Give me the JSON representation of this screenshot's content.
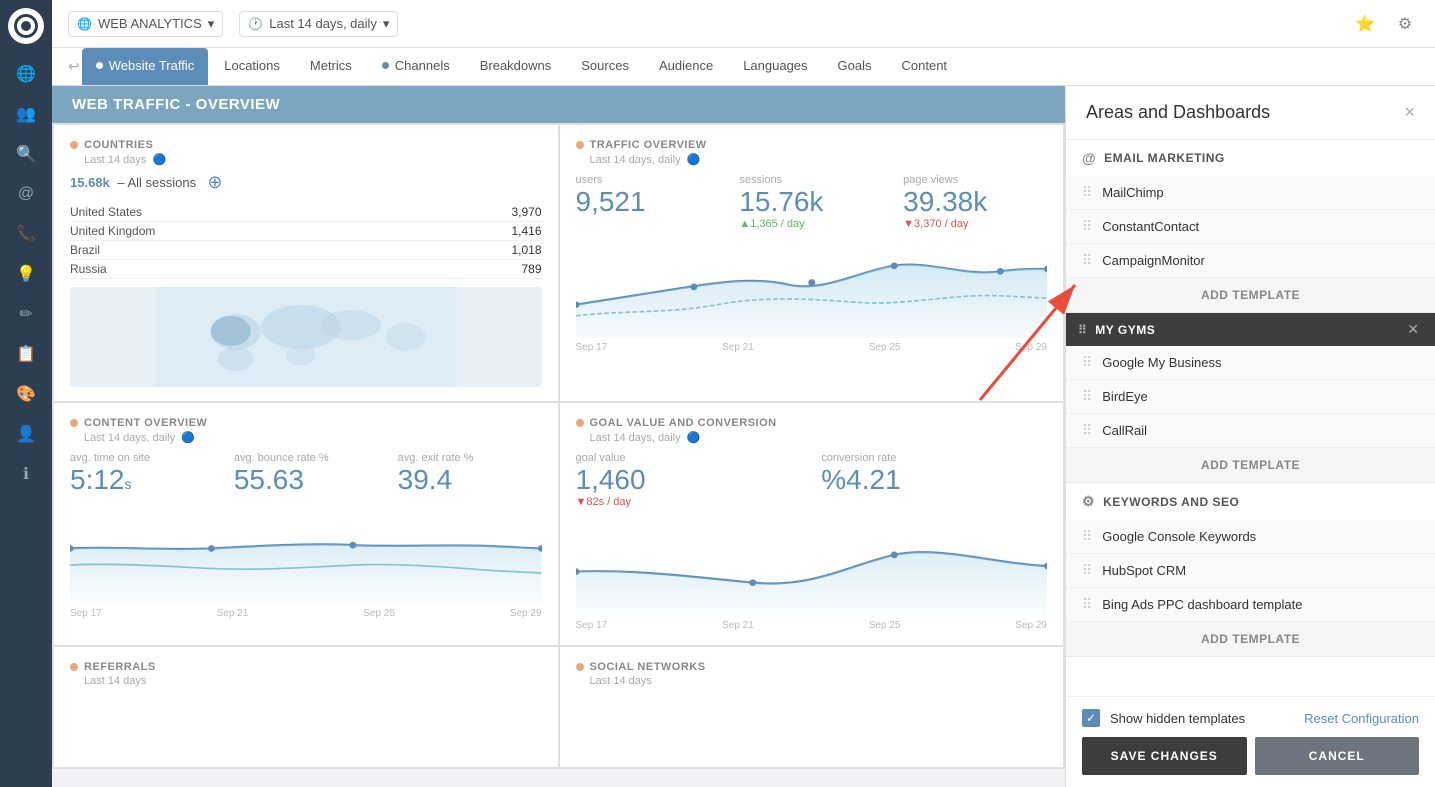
{
  "app": {
    "logo_label": "App Logo"
  },
  "topbar": {
    "analytics_label": "WEB ANALYTICS",
    "date_range": "Last 14 days, daily",
    "dropdown_icon": "▾"
  },
  "nav": {
    "breadcrumb_icon": "↩",
    "tabs": [
      {
        "label": "Website Traffic",
        "active": true,
        "dot": true
      },
      {
        "label": "Locations",
        "active": false,
        "dot": false
      },
      {
        "label": "Metrics",
        "active": false,
        "dot": false
      },
      {
        "label": "Channels",
        "active": false,
        "dot": true
      },
      {
        "label": "Breakdowns",
        "active": false,
        "dot": false
      },
      {
        "label": "Sources",
        "active": false,
        "dot": false
      },
      {
        "label": "Audience",
        "active": false,
        "dot": false
      },
      {
        "label": "Languages",
        "active": false,
        "dot": false
      },
      {
        "label": "Goals",
        "active": false,
        "dot": false
      },
      {
        "label": "Content",
        "active": false,
        "dot": false
      }
    ]
  },
  "dashboard": {
    "header": "WEB TRAFFIC - OVERVIEW",
    "widgets": [
      {
        "id": "countries",
        "title": "COUNTRIES",
        "subtitle": "Last 14 days",
        "countries": [
          {
            "name": "United States",
            "value": "3,970"
          },
          {
            "name": "United Kingdom",
            "value": "1,416"
          },
          {
            "name": "Brazil",
            "value": "1,018"
          },
          {
            "name": "Russia",
            "value": "789"
          }
        ],
        "all_sessions_label": "15.68k – All sessions"
      },
      {
        "id": "traffic_overview",
        "title": "TRAFFIC OVERVIEW",
        "subtitle": "Last 14 days, daily",
        "metrics": [
          {
            "label": "users",
            "value": "9,521",
            "sub": ""
          },
          {
            "label": "sessions",
            "value": "15.76k",
            "sub": "▲1,365 / day"
          },
          {
            "label": "page views",
            "value": "39.38k",
            "sub": "▼3,370 / day"
          }
        ],
        "x_labels": [
          "Sep 17",
          "Sep 21",
          "Sep 25",
          "Sep 29"
        ]
      },
      {
        "id": "content_overview",
        "title": "CONTENT OVERVIEW",
        "subtitle": "Last 14 days, daily",
        "metrics": [
          {
            "label": "avg. time on site",
            "value": "5:12s"
          },
          {
            "label": "avg. bounce rate %",
            "value": "55.63"
          },
          {
            "label": "avg. exit rate %",
            "value": "39.4"
          }
        ],
        "x_labels": [
          "Sep 17",
          "Sep 21",
          "Sep 25",
          "Sep 29"
        ]
      },
      {
        "id": "goal_value",
        "title": "GOAL VALUE AND CONVERSION",
        "subtitle": "Last 14 days, daily",
        "metrics": [
          {
            "label": "goal value",
            "value": "1,460",
            "sub": "▼82s / day"
          },
          {
            "label": "conversion rate",
            "value": "%4.21",
            "sub": ""
          }
        ],
        "x_labels": [
          "Sep 17",
          "Sep 21",
          "Sep 25",
          "Sep 29"
        ]
      },
      {
        "id": "referrals",
        "title": "REFERRALS",
        "subtitle": "Last 14 days"
      },
      {
        "id": "social_networks",
        "title": "SOCIAL NETWORKS",
        "subtitle": "Last 14 days"
      }
    ]
  },
  "panel": {
    "title": "Areas and Dashboards",
    "close_label": "×",
    "sections": [
      {
        "id": "email_marketing",
        "icon": "@",
        "label": "EMAIL MARKETING",
        "highlighted": false,
        "templates": [
          {
            "name": "MailChimp"
          },
          {
            "name": "ConstantContact"
          },
          {
            "name": "CampaignMonitor"
          }
        ],
        "add_label": "ADD TEMPLATE"
      },
      {
        "id": "my_gyms",
        "icon": "",
        "label": "MY GYMS",
        "highlighted": true,
        "templates": [
          {
            "name": "Google My Business"
          },
          {
            "name": "BirdEye"
          },
          {
            "name": "CallRail"
          }
        ],
        "add_label": "ADD TEMPLATE"
      },
      {
        "id": "keywords_seo",
        "icon": "⚙",
        "label": "KEYWORDS AND SEO",
        "highlighted": false,
        "templates": [
          {
            "name": "Google Console Keywords"
          },
          {
            "name": "HubSpot CRM"
          },
          {
            "name": "Bing Ads PPC dashboard template"
          }
        ],
        "add_label": "ADD TEMPLATE"
      }
    ],
    "footer": {
      "show_hidden": "Show hidden templates",
      "reset_label": "Reset Configuration",
      "save_label": "SAVE CHANGES",
      "cancel_label": "CANCEL"
    }
  },
  "sidebar_icons": [
    {
      "name": "globe-icon",
      "symbol": "🌐"
    },
    {
      "name": "users-icon",
      "symbol": "👥"
    },
    {
      "name": "search-icon",
      "symbol": "🔍"
    },
    {
      "name": "at-icon",
      "symbol": "@"
    },
    {
      "name": "phone-icon",
      "symbol": "📞"
    },
    {
      "name": "bulb-icon",
      "symbol": "💡"
    },
    {
      "name": "edit-icon",
      "symbol": "✏"
    },
    {
      "name": "clipboard-icon",
      "symbol": "📋"
    },
    {
      "name": "palette-icon",
      "symbol": "🎨"
    },
    {
      "name": "user-icon",
      "symbol": "👤"
    },
    {
      "name": "info-icon",
      "symbol": "ℹ"
    }
  ]
}
